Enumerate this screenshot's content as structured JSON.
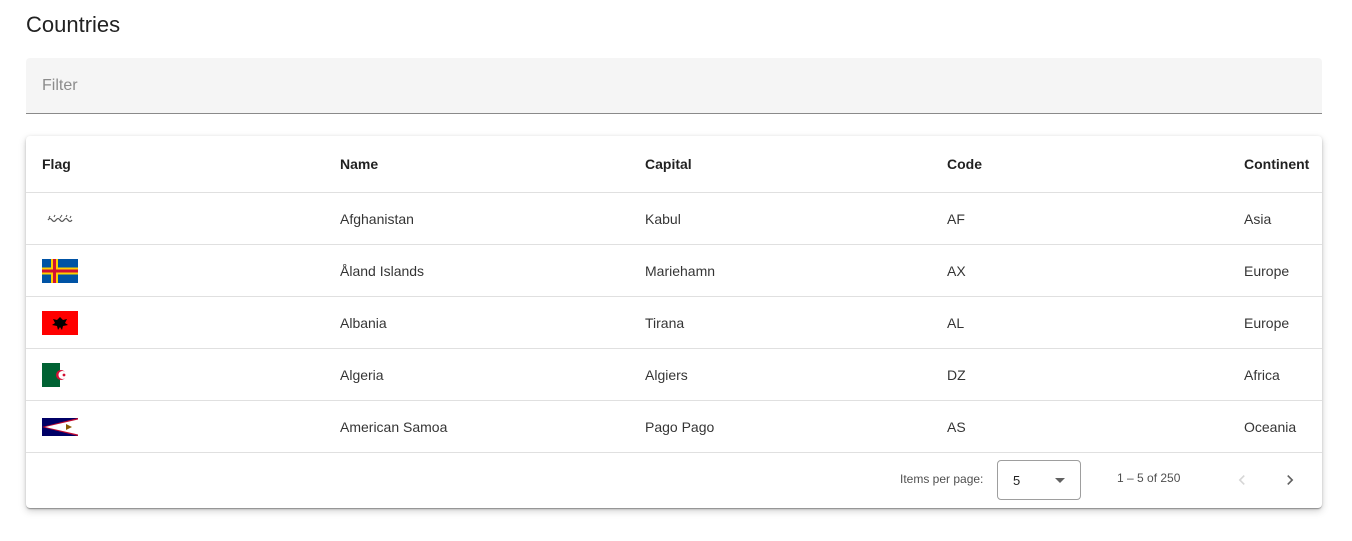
{
  "page": {
    "title": "Countries"
  },
  "filter": {
    "placeholder": "Filter",
    "value": ""
  },
  "table": {
    "columns": [
      "Flag",
      "Name",
      "Capital",
      "Code",
      "Continent"
    ],
    "rows": [
      {
        "flag": "afghanistan-flag-icon",
        "name": "Afghanistan",
        "capital": "Kabul",
        "code": "AF",
        "continent": "Asia"
      },
      {
        "flag": "aland-islands-flag-icon",
        "name": "Åland Islands",
        "capital": "Mariehamn",
        "code": "AX",
        "continent": "Europe"
      },
      {
        "flag": "albania-flag-icon",
        "name": "Albania",
        "capital": "Tirana",
        "code": "AL",
        "continent": "Europe"
      },
      {
        "flag": "algeria-flag-icon",
        "name": "Algeria",
        "capital": "Algiers",
        "code": "DZ",
        "continent": "Africa"
      },
      {
        "flag": "american-samoa-flag-icon",
        "name": "American Samoa",
        "capital": "Pago Pago",
        "code": "AS",
        "continent": "Oceania"
      }
    ]
  },
  "paginator": {
    "items_per_page_label": "Items per page:",
    "page_size": "5",
    "range_label": "1 – 5 of 250",
    "prev_icon": "chevron-left-icon",
    "next_icon": "chevron-right-icon",
    "prev_disabled": true
  },
  "colors": {
    "aland_blue": "#0053a5",
    "aland_yellow": "#ffce00",
    "aland_red": "#d21034",
    "albania_red": "#ff0000",
    "algeria_green": "#006233",
    "algeria_red": "#d21034",
    "samoa_navy": "#000066",
    "samoa_red": "#bf0a30"
  }
}
